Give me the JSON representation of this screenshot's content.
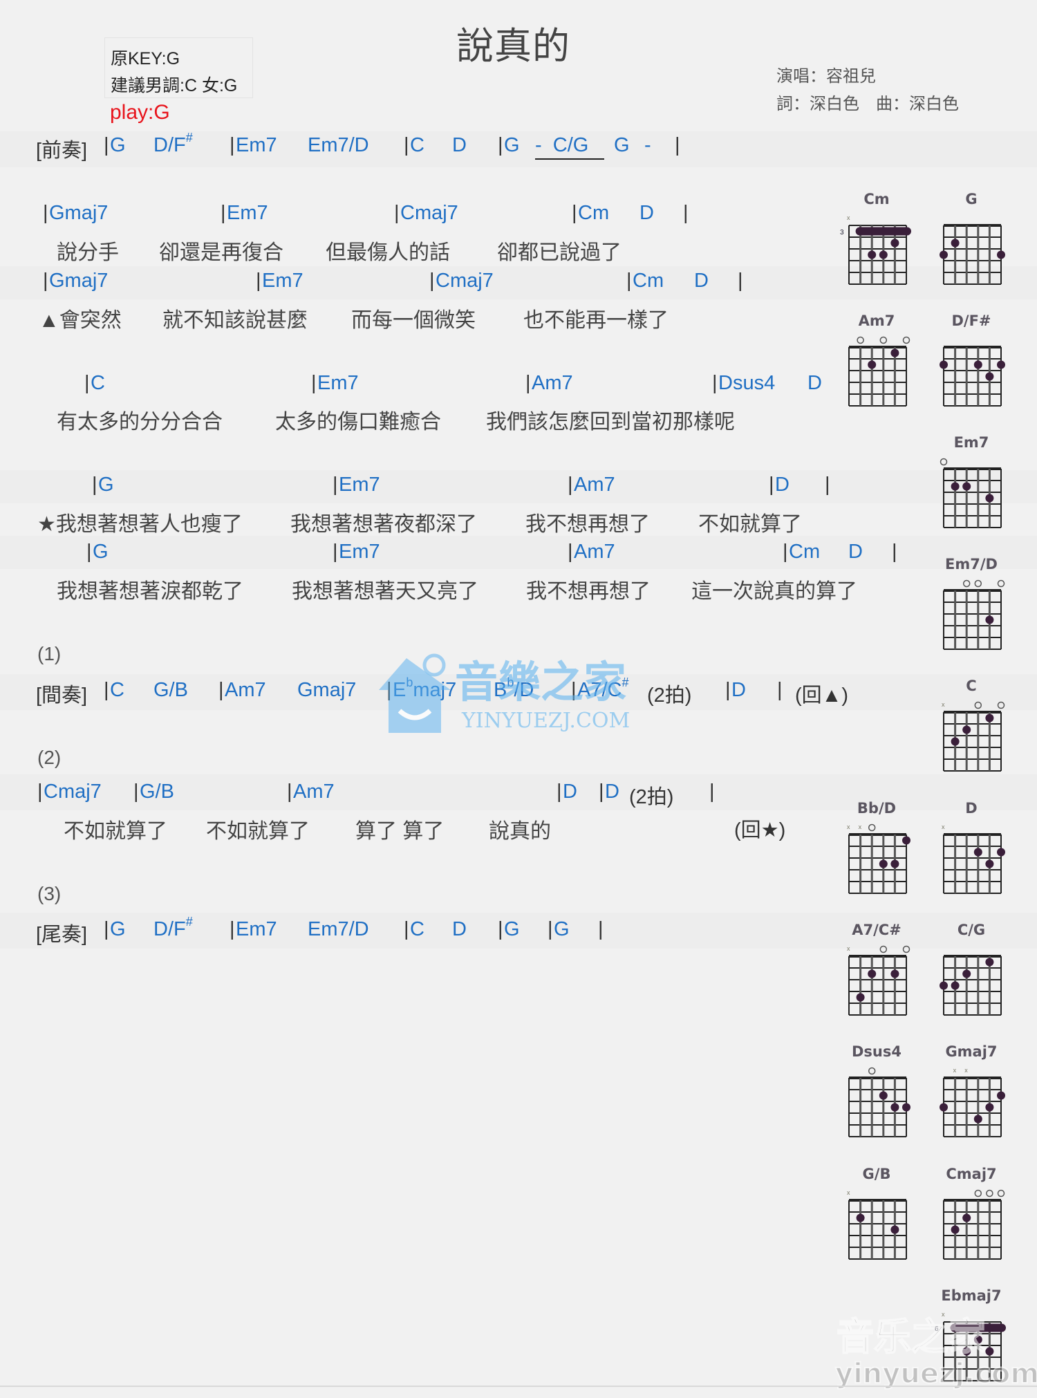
{
  "header": {
    "title": "說真的",
    "original_key": "原KEY:G",
    "suggested_key": "建議男調:C 女:G",
    "play_key": "play:G",
    "singer": "演唱：容祖兒",
    "credits": "詞：深白色　曲：深白色"
  },
  "sections": {
    "prelude": {
      "label": "[前奏]",
      "chords": [
        "G",
        "D/F",
        "Em7",
        "Em7/D",
        "C",
        "D",
        "G",
        "-",
        "C/G",
        "G",
        "-"
      ],
      "sharp": "#"
    },
    "verse": {
      "line1_chords": [
        "Gmaj7",
        "Em7",
        "Cmaj7",
        "Cm",
        "D"
      ],
      "line1_lyrics": [
        "說分手",
        "卻還是再復合",
        "但最傷人的話",
        "卻都已說過了"
      ],
      "line2_chords": [
        "Gmaj7",
        "Em7",
        "Cmaj7",
        "Cm",
        "D"
      ],
      "line2_lyrics": [
        "▲會突然",
        "就不知該說甚麼",
        "而每一個微笑",
        "也不能再一樣了"
      ]
    },
    "prechorus": {
      "chords": [
        "C",
        "Em7",
        "Am7",
        "Dsus4",
        "D"
      ],
      "lyrics": [
        "有太多的分分合合",
        "太多的傷口難癒合",
        "我們該怎麼回到當初那樣呢"
      ]
    },
    "chorus": {
      "line1_chords": [
        "G",
        "Em7",
        "Am7",
        "D"
      ],
      "line1_lyrics": [
        "★我想著想著人也瘦了",
        "我想著想著夜都深了",
        "我不想再想了",
        "不如就算了"
      ],
      "line2_chords": [
        "G",
        "Em7",
        "Am7",
        "Cm",
        "D"
      ],
      "line2_lyrics": [
        "我想著想著淚都乾了",
        "我想著想著天又亮了",
        "我不想再想了",
        "這一次說真的算了"
      ]
    },
    "part1": {
      "marker": "(1)",
      "label": "[間奏]",
      "chords": [
        "C",
        "G/B",
        "Am7",
        "Gmaj7",
        "E",
        "maj7",
        "B",
        "/D",
        "A7/C",
        "D"
      ],
      "flat": "b",
      "sharp": "#",
      "beats": "(2拍)",
      "repeat": "(回▲)"
    },
    "part2": {
      "marker": "(2)",
      "chords": [
        "Cmaj7",
        "G/B",
        "Am7",
        "D",
        "D"
      ],
      "beats": "(2拍)",
      "lyrics": [
        "不如就算了",
        "不如就算了",
        "算了 算了",
        "說真的"
      ],
      "repeat": "(回★)"
    },
    "part3": {
      "marker": "(3)",
      "label": "[尾奏]",
      "chords": [
        "G",
        "D/F",
        "Em7",
        "Em7/D",
        "C",
        "D",
        "G",
        "G"
      ],
      "sharp": "#"
    }
  },
  "chord_diagrams": [
    {
      "name": "Cm",
      "fret_label": "3",
      "mutes": [
        0
      ],
      "opens": [],
      "barre": [
        1,
        1,
        5
      ],
      "dots": [
        [
          4,
          2
        ],
        [
          2,
          3
        ],
        [
          3,
          3
        ]
      ]
    },
    {
      "name": "G",
      "fret_label": "",
      "mutes": [],
      "opens": [],
      "barre": null,
      "dots": [
        [
          1,
          2
        ],
        [
          0,
          3
        ],
        [
          5,
          3
        ]
      ]
    },
    {
      "name": "Am7",
      "fret_label": "",
      "mutes": [],
      "opens": [
        1,
        3,
        5
      ],
      "barre": null,
      "dots": [
        [
          4,
          1
        ],
        [
          2,
          2
        ]
      ]
    },
    {
      "name": "D/F#",
      "fret_label": "",
      "mutes": [],
      "opens": [],
      "barre": null,
      "dots": [
        [
          0,
          2
        ],
        [
          3,
          2
        ],
        [
          5,
          2
        ],
        [
          4,
          3
        ]
      ]
    },
    {
      "name": "Em7",
      "fret_label": "",
      "mutes": [],
      "opens": [
        0
      ],
      "barre": null,
      "dots": [
        [
          1,
          2
        ],
        [
          2,
          2
        ],
        [
          4,
          3
        ]
      ]
    },
    {
      "name": "Em7/D",
      "fret_label": "",
      "mutes": [],
      "opens": [
        2,
        3,
        5
      ],
      "barre": null,
      "dots": [
        [
          4,
          3
        ]
      ]
    },
    {
      "name": "C",
      "fret_label": "",
      "mutes": [
        0
      ],
      "opens": [
        3,
        5
      ],
      "barre": null,
      "dots": [
        [
          4,
          1
        ],
        [
          2,
          2
        ],
        [
          1,
          3
        ]
      ]
    },
    {
      "name": "Bb/D",
      "fret_label": "",
      "mutes": [
        0,
        1
      ],
      "opens": [
        2
      ],
      "barre": null,
      "dots": [
        [
          5,
          1
        ],
        [
          3,
          3
        ],
        [
          4,
          3
        ]
      ]
    },
    {
      "name": "D",
      "fret_label": "",
      "mutes": [
        0
      ],
      "opens": [],
      "barre": null,
      "dots": [
        [
          3,
          2
        ],
        [
          5,
          2
        ],
        [
          4,
          3
        ]
      ]
    },
    {
      "name": "A7/C#",
      "fret_label": "",
      "mutes": [
        0
      ],
      "opens": [
        3,
        5
      ],
      "barre": null,
      "dots": [
        [
          2,
          2
        ],
        [
          4,
          2
        ],
        [
          1,
          4
        ]
      ]
    },
    {
      "name": "C/G",
      "fret_label": "",
      "mutes": [],
      "opens": [],
      "barre": null,
      "dots": [
        [
          4,
          1
        ],
        [
          2,
          2
        ],
        [
          0,
          3
        ],
        [
          1,
          3
        ]
      ]
    },
    {
      "name": "Dsus4",
      "fret_label": "",
      "mutes": [],
      "opens": [
        2
      ],
      "barre": null,
      "dots": [
        [
          3,
          2
        ],
        [
          4,
          3
        ],
        [
          5,
          3
        ]
      ]
    },
    {
      "name": "Gmaj7",
      "fret_label": "",
      "mutes": [
        1,
        2
      ],
      "opens": [],
      "barre": null,
      "dots": [
        [
          5,
          2
        ],
        [
          0,
          3
        ],
        [
          4,
          3
        ],
        [
          3,
          4
        ]
      ]
    },
    {
      "name": "G/B",
      "fret_label": "",
      "mutes": [
        0
      ],
      "opens": [],
      "barre": null,
      "dots": [
        [
          1,
          2
        ],
        [
          4,
          3
        ]
      ]
    },
    {
      "name": "Cmaj7",
      "fret_label": "",
      "mutes": [],
      "opens": [
        3,
        4,
        5
      ],
      "barre": null,
      "dots": [
        [
          2,
          2
        ],
        [
          1,
          3
        ]
      ]
    },
    {
      "name": "Ebmaj7",
      "fret_label": "6",
      "mutes": [
        0
      ],
      "opens": [],
      "barre": [
        1,
        1,
        5
      ],
      "dots": [
        [
          3,
          2
        ],
        [
          2,
          3
        ],
        [
          4,
          3
        ]
      ]
    }
  ],
  "watermark": {
    "center_text_cn": "音樂之家",
    "center_text_en": "YINYUEZJ.COM",
    "corner_text_cn": "音乐之家",
    "corner_text_en": "yinyuezj.com",
    "color": "#5ab0ee"
  },
  "colors": {
    "chord": "#1f6fc4",
    "lyric": "#444444",
    "play_key": "#e8141c"
  }
}
